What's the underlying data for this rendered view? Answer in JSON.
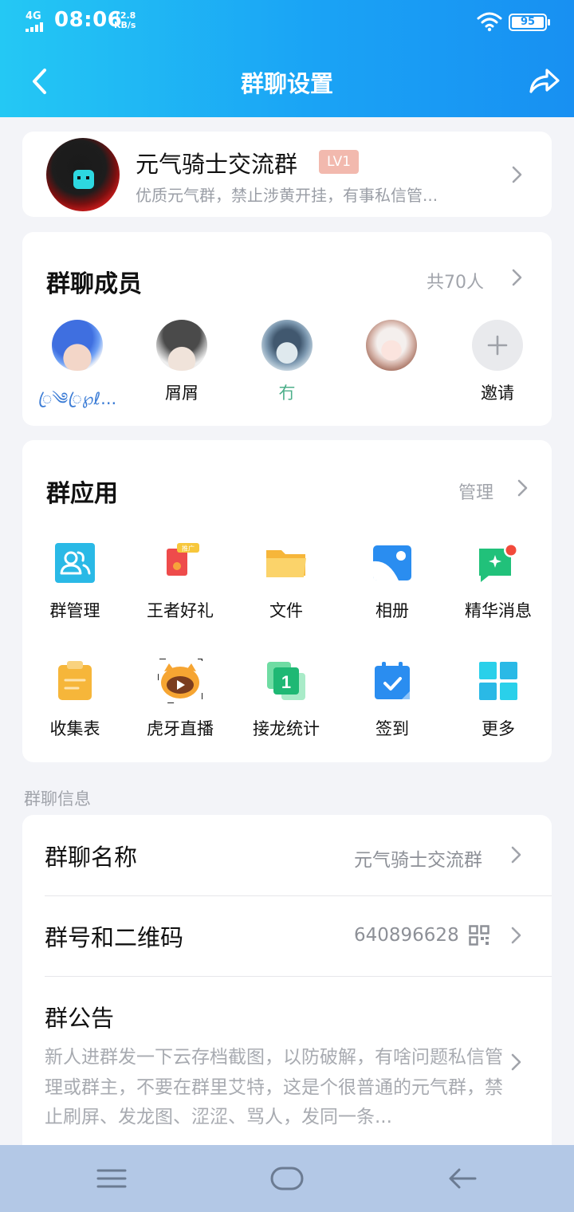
{
  "status_bar": {
    "network": "4G",
    "time": "08:06",
    "speed_value": "12.8",
    "speed_unit": "KB/s",
    "battery": "95"
  },
  "nav": {
    "title": "群聊设置",
    "back_icon": "chevron-left-icon",
    "share_icon": "share-icon"
  },
  "group": {
    "name": "元气骑士交流群",
    "level": "LV1",
    "description": "优质元气群，禁止涉黄开挂，有事私信管..."
  },
  "members": {
    "title": "群聊成员",
    "count": "共70人",
    "list": [
      {
        "name": "ꦿ༄ꦿ℘ℓ..."
      },
      {
        "name": "屑屑"
      },
      {
        "name": "冇"
      }
    ],
    "invite_label": "邀请"
  },
  "apps": {
    "title": "群应用",
    "manage": "管理",
    "items": [
      {
        "label": "群管理",
        "icon": "group-manage-icon"
      },
      {
        "label": "王者好礼",
        "icon": "gift-icon",
        "tag": "推广"
      },
      {
        "label": "文件",
        "icon": "folder-icon"
      },
      {
        "label": "相册",
        "icon": "photo-album-icon"
      },
      {
        "label": "精华消息",
        "icon": "featured-message-icon"
      },
      {
        "label": "收集表",
        "icon": "clipboard-icon"
      },
      {
        "label": "虎牙直播",
        "icon": "huya-live-icon"
      },
      {
        "label": "接龙统计",
        "icon": "chain-stats-icon"
      },
      {
        "label": "签到",
        "icon": "checkin-calendar-icon"
      },
      {
        "label": "更多",
        "icon": "grid-more-icon"
      }
    ]
  },
  "info": {
    "section_label": "群聊信息",
    "name_title": "群聊名称",
    "name_value": "元气骑士交流群",
    "id_title": "群号和二维码",
    "id_value": "640896628",
    "notice_title": "群公告",
    "notice_text": "新人进群发一下云存档截图，以防破解，有啥问题私信管理或群主，不要在群里艾特，这是个很普通的元气群，禁止刷屏、发龙图、涩涩、骂人，发同一条..."
  },
  "colors": {
    "header_start": "#24c8f4",
    "header_end": "#1890f2",
    "background": "#f3f4f8",
    "lv_badge": "#f2b9ae",
    "system_nav": "#b3c8e6"
  }
}
